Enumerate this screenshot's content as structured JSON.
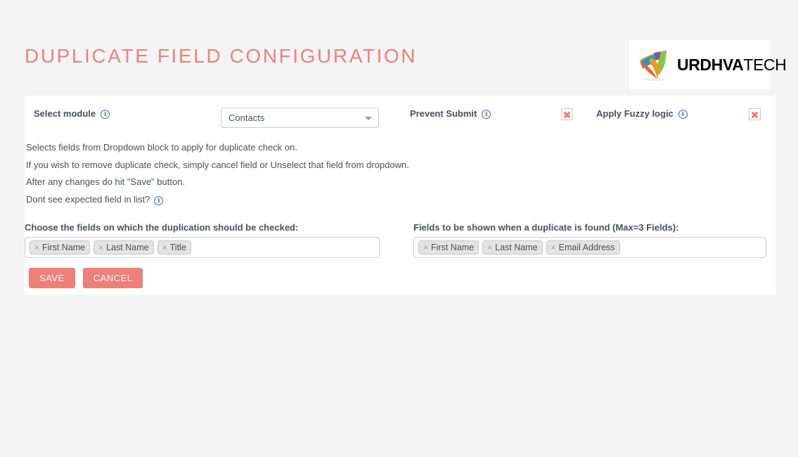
{
  "page": {
    "title": "DUPLICATE FIELD CONFIGURATION",
    "background_color": "#f4f4f4",
    "accent_color": "#ef8078",
    "title_color": "#e8837c"
  },
  "logo": {
    "name_bold": "URDHVA",
    "name_regular": "TECH",
    "mark_colors": [
      "#f47b20",
      "#8e4c9e",
      "#8cc63f",
      "#00a0e3",
      "#f26322"
    ]
  },
  "form": {
    "select_module": {
      "label": "Select module",
      "info_icon": "info-icon",
      "value": "Contacts",
      "caret_icon": "chevron-down-icon"
    },
    "prevent_submit": {
      "label": "Prevent Submit",
      "info_icon": "info-icon",
      "state_icon": "red-x-icon",
      "checked": false
    },
    "apply_fuzzy_logic": {
      "label": "Apply Fuzzy logic",
      "info_icon": "info-icon",
      "state_icon": "red-x-icon",
      "checked": false
    }
  },
  "instructions": [
    {
      "text": "Selects fields from Dropdown block to apply for duplicate check on.",
      "has_info": false
    },
    {
      "text": "If you wish to remove duplicate check, simply cancel field or Unselect that field from dropdown.",
      "has_info": false
    },
    {
      "text": "After any changes do hit \"Save\" button.",
      "has_info": false
    },
    {
      "text": "Dont see expected field in list?",
      "has_info": true
    }
  ],
  "duplicate_check_fields": {
    "heading": "Choose the fields on which the duplication should be checked:",
    "tokens": [
      "First Name",
      "Last Name",
      "Title"
    ],
    "remove_icon": "close-x-icon"
  },
  "display_fields": {
    "heading": "Fields to be shown when a duplicate is found (Max=3 Fields):",
    "tokens": [
      "First Name",
      "Last Name",
      "Email Address"
    ],
    "remove_icon": "close-x-icon"
  },
  "buttons": {
    "save": "SAVE",
    "cancel": "CANCEL"
  }
}
